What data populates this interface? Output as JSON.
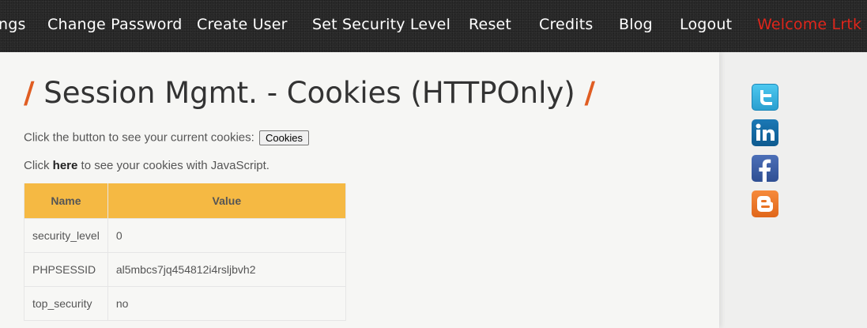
{
  "nav": {
    "items": [
      {
        "label": "ngs"
      },
      {
        "label": "Change Password"
      },
      {
        "label": "Create User"
      },
      {
        "label": "Set Security Level"
      },
      {
        "label": "Reset"
      },
      {
        "label": "Credits"
      },
      {
        "label": "Blog"
      },
      {
        "label": "Logout"
      }
    ],
    "welcome": "Welcome Lrtk"
  },
  "page": {
    "title_slash": "/",
    "title": "Session Mgmt. - Cookies (HTTPOnly)",
    "intro": "Click the button to see your current cookies:",
    "cookies_button": "Cookies",
    "js_prefix": "Click",
    "js_link": "here",
    "js_suffix": "to see your cookies with JavaScript."
  },
  "table": {
    "headers": [
      "Name",
      "Value"
    ],
    "rows": [
      {
        "name": "security_level",
        "value": "0"
      },
      {
        "name": "PHPSESSID",
        "value": "al5mbcs7jq454812i4rsljbvh2"
      },
      {
        "name": "top_security",
        "value": "no"
      }
    ]
  },
  "social": [
    "twitter-icon",
    "linkedin-icon",
    "facebook-icon",
    "blogger-icon"
  ],
  "colors": {
    "nav_bg": "#2b2b2b",
    "welcome": "#e0251b",
    "slash": "#e05d22",
    "header": "#f5b943"
  }
}
